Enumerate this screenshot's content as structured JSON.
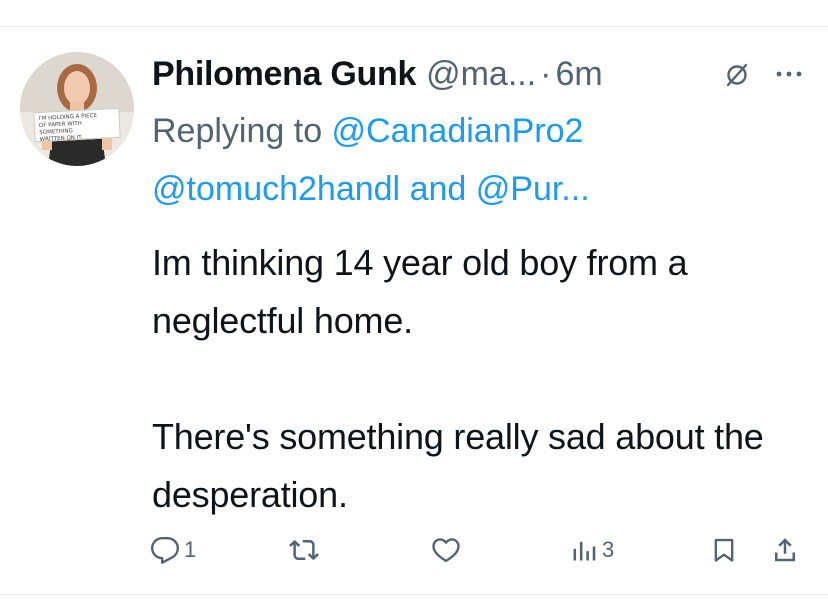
{
  "tweet": {
    "display_name": "Philomena Gunk",
    "handle": "@ma...",
    "separator": "·",
    "time": "6m",
    "replying_prefix": "Replying to ",
    "reply_user_1": "@CanadianPro2",
    "reply_user_2": "@tomuch2handl",
    "reply_joiner": " and ",
    "reply_user_3": "@Pur...",
    "text": "Im thinking 14 year old boy from a neglectful home.\n\nThere's something really sad about the desperation."
  },
  "avatar": {
    "sign_line_1": "I'M HOLDING A PIECE",
    "sign_line_2": "OF PAPER WITH SOMETHING",
    "sign_line_3": "WRITTEN ON IT."
  },
  "actions": {
    "reply_count": "1",
    "views_count": "3"
  },
  "colors": {
    "text": "#0f1419",
    "muted": "#536471",
    "link": "#1d9bf0"
  },
  "icons": [
    "grok-icon",
    "more-icon",
    "reply-icon",
    "retweet-icon",
    "like-icon",
    "views-icon",
    "bookmark-icon",
    "share-icon"
  ]
}
